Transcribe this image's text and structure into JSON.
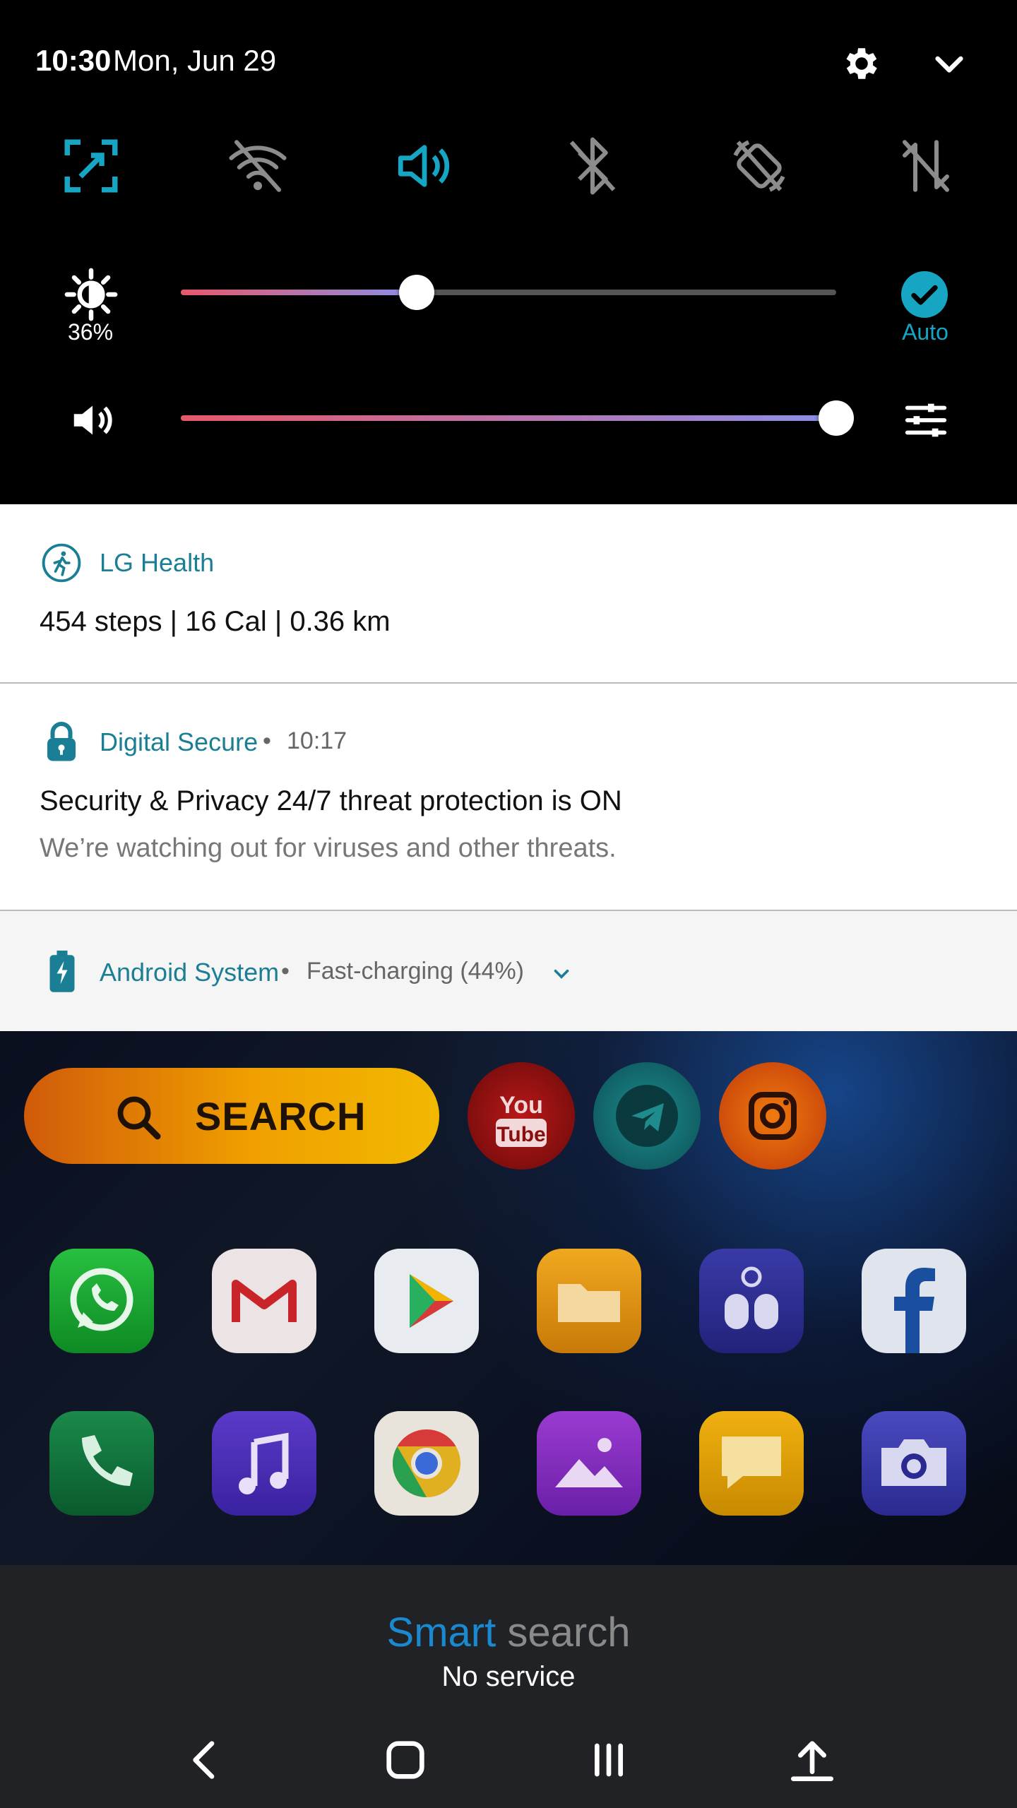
{
  "status_bar": {
    "time": "10:30",
    "date": "Mon, Jun 29"
  },
  "quick_settings": {
    "toggles": [
      "screen-capture-icon",
      "wifi-off-icon",
      "sound-icon",
      "bluetooth-off-icon",
      "auto-rotate-off-icon",
      "mobile-data-off-icon"
    ],
    "brightness": {
      "percent_label": "36%",
      "level": 0.36,
      "auto_label": "Auto"
    },
    "volume": {
      "level": 1.0
    }
  },
  "notifications": [
    {
      "app": "LG Health",
      "title": "454 steps | 16 Cal | 0.36 km"
    },
    {
      "app": "Digital Secure",
      "time": "10:17",
      "title": "Security & Privacy 24/7 threat protection is ON",
      "text": "We’re watching out for viruses and other threats."
    },
    {
      "app": "Android System",
      "status": "Fast-charging (44%)"
    }
  ],
  "home": {
    "search_label": "SEARCH",
    "row1": [
      "whatsapp",
      "gmail",
      "play-store",
      "files",
      "remote",
      "facebook"
    ],
    "row2": [
      "phone",
      "music",
      "chrome",
      "gallery",
      "messages",
      "camera"
    ]
  },
  "smart_search": {
    "word1": "Smart",
    "word2": "search",
    "status": "No service"
  },
  "colors": {
    "accent": "#16a6c4",
    "app_name": "#1a7f95"
  }
}
